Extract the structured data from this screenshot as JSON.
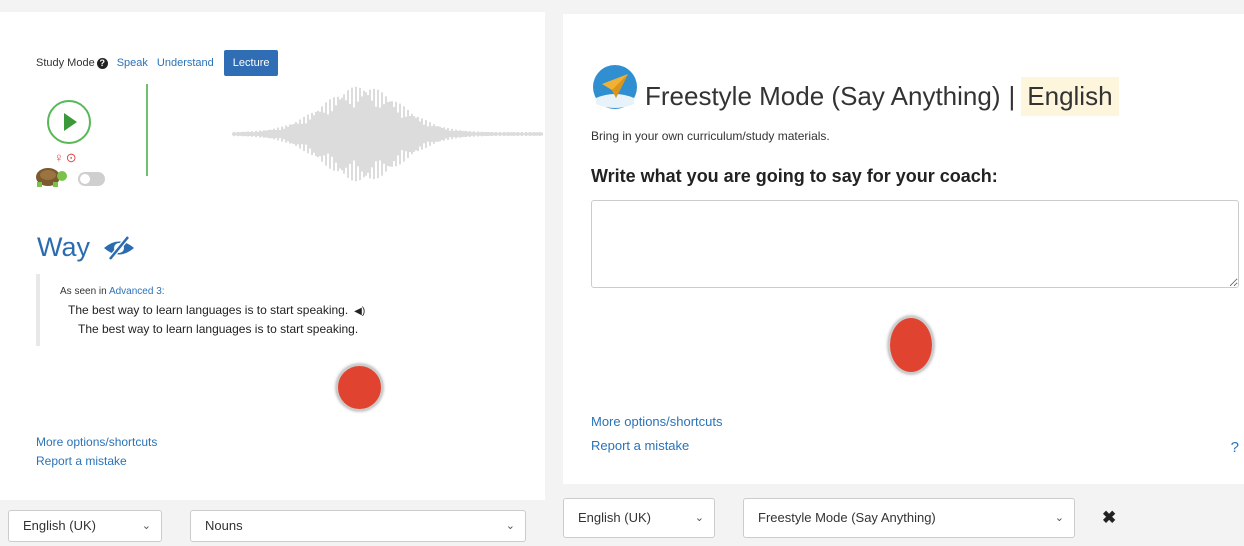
{
  "left": {
    "study_mode_label": "Study Mode",
    "help_glyph": "?",
    "modes": [
      "Speak",
      "Understand",
      "Lecture"
    ],
    "active_mode": "Lecture",
    "play_icon": "play-icon",
    "tiny_icons": "♀⊙",
    "word": "Way",
    "example_seen_prefix": "As seen in",
    "example_seen_link": "Advanced 3:",
    "example_sentence_1": "The best way to learn languages is to start speaking.",
    "speaker_glyph": "◀)",
    "example_sentence_2": "The best way to learn languages is to start speaking.",
    "more_options": "More options/shortcuts",
    "report_mistake": "Report a mistake"
  },
  "right": {
    "title": "Freestyle Mode (Say Anything)",
    "title_separator": "|",
    "title_language": "English",
    "subtitle": "Bring in your own curriculum/study materials.",
    "prompt": "Write what you are going to say for your coach:",
    "textarea_value": "",
    "more_options": "More options/shortcuts",
    "report_mistake": "Report a mistake",
    "help": "?"
  },
  "bottom_bar": {
    "left_language": "English (UK)",
    "left_category": "Nouns",
    "right_language": "English (UK)",
    "right_mode": "Freestyle Mode (Say Anything)",
    "close": "✖",
    "chevron": "⌄"
  },
  "colors": {
    "accent_blue": "#2a73b8",
    "active_tab": "#2f6db5",
    "record_red": "#e04430",
    "play_green": "#58b858",
    "highlight": "#fdf6dd"
  }
}
